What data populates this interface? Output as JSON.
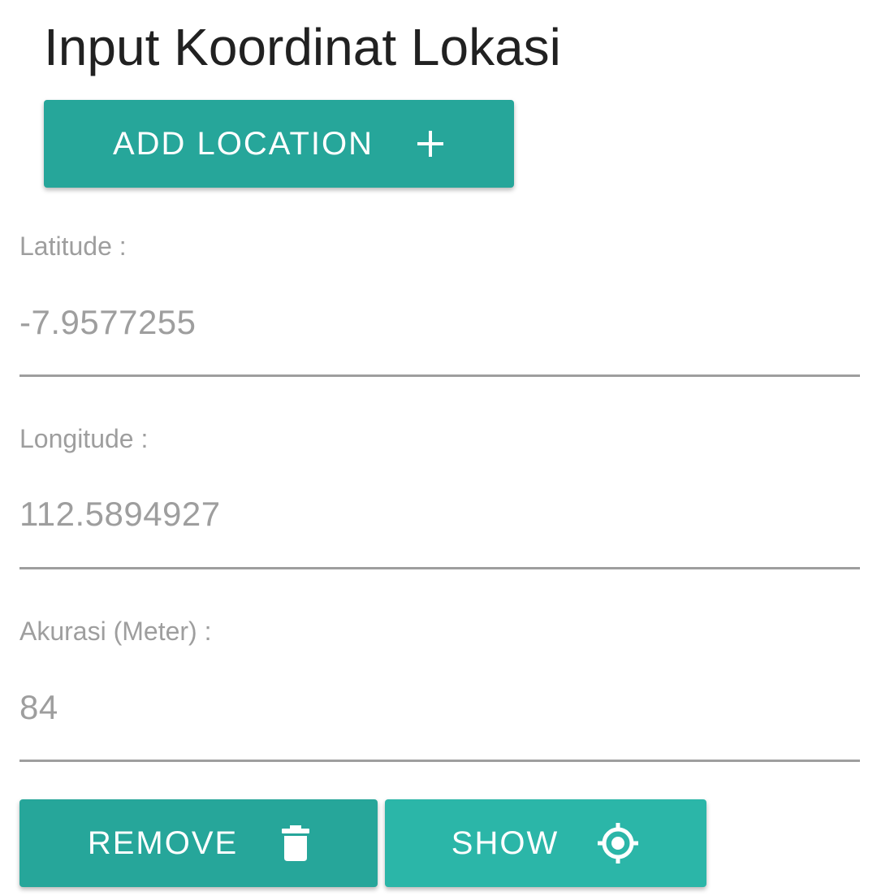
{
  "page": {
    "title": "Input Koordinat Lokasi"
  },
  "add_button": {
    "label": "ADD LOCATION",
    "icon": "plus-icon"
  },
  "fields": {
    "latitude": {
      "label": "Latitude :",
      "value": "-7.9577255"
    },
    "longitude": {
      "label": "Longitude :",
      "value": "112.5894927"
    },
    "accuracy": {
      "label": "Akurasi (Meter) :",
      "value": "84"
    }
  },
  "actions": {
    "remove": {
      "label": "REMOVE",
      "icon": "trash-icon"
    },
    "show": {
      "label": "SHOW",
      "icon": "crosshair-icon"
    }
  },
  "colors": {
    "primary": "#26a69a",
    "primary_light": "#2bb6a8",
    "title_text": "#212121",
    "muted_text": "#9e9e9e"
  }
}
